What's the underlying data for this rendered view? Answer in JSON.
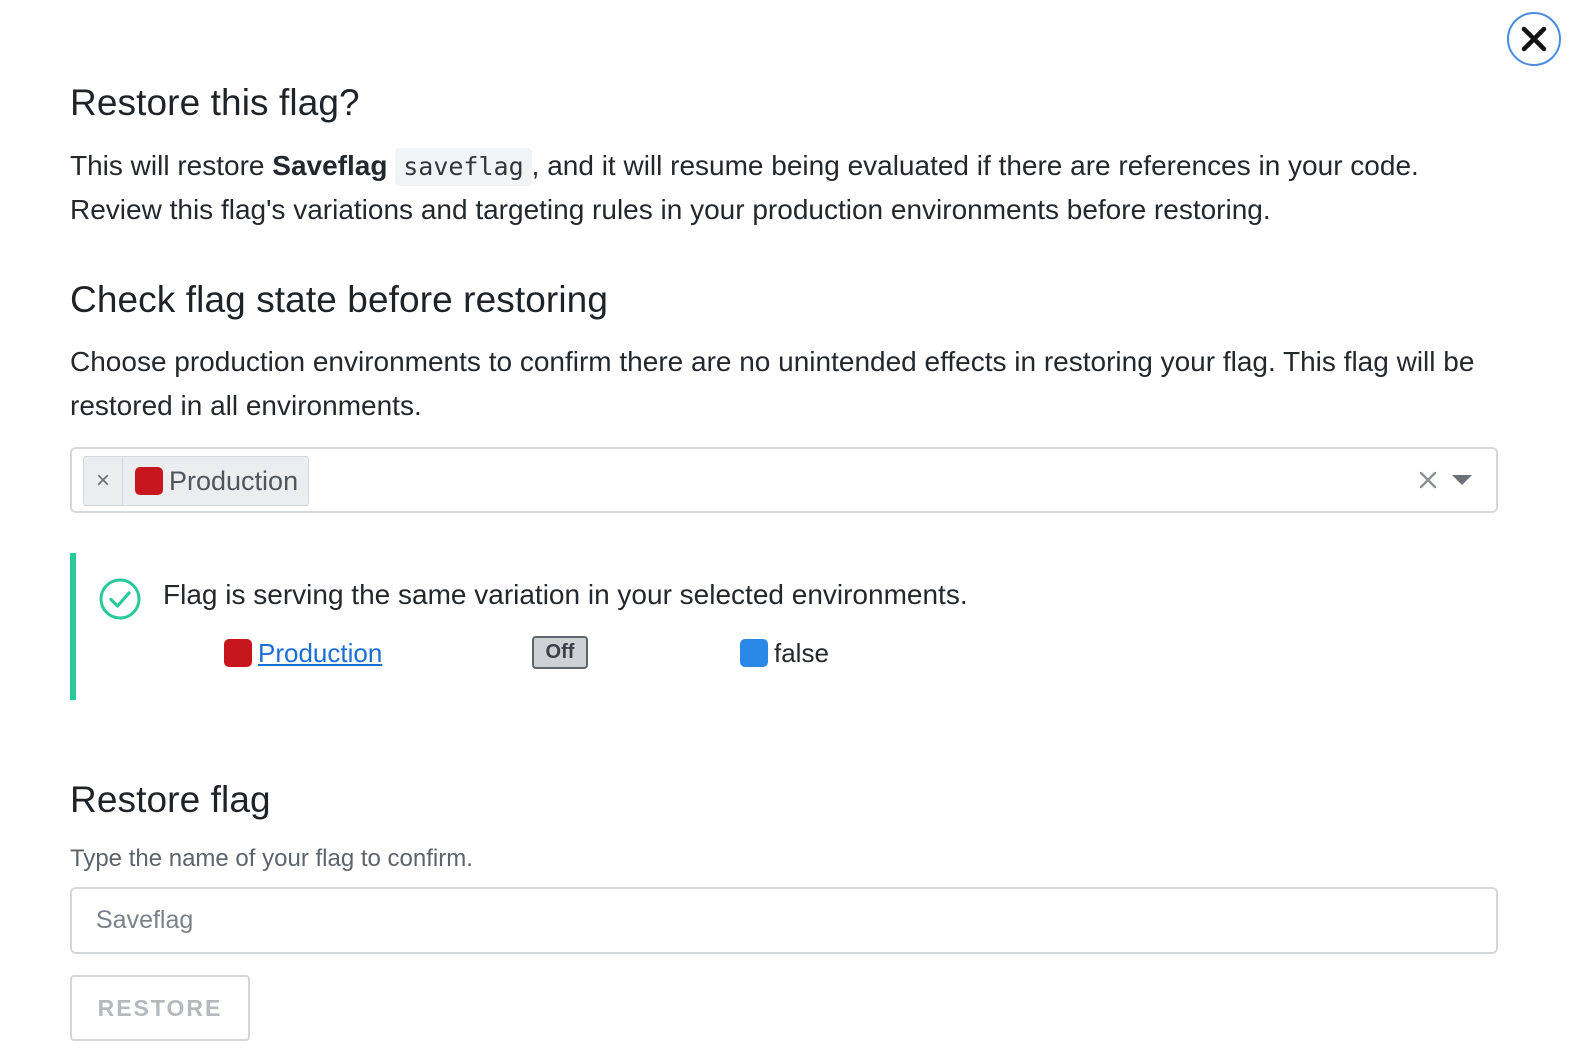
{
  "dialog": {
    "close_icon": "close-icon",
    "title": "Restore this flag?",
    "intro": {
      "before": "This will restore ",
      "flag_name": "Saveflag",
      "flag_key": "saveflag",
      "after": ", and it will resume being evaluated if there are references in your code. Review this flag's variations and targeting rules in your production environments before restoring."
    }
  },
  "check": {
    "title": "Check flag state before restoring",
    "description": "Choose production environments to confirm there are no unintended effects in restoring your flag. This flag will be restored in all environments.",
    "selected_environments": [
      {
        "name": "Production",
        "color": "#c7161d"
      }
    ],
    "chip_remove_label": "×",
    "clear_icon": "clear-icon",
    "dropdown_icon": "chevron-down-icon"
  },
  "status": {
    "icon": "check-circle-icon",
    "accent_color": "#2bc89a",
    "message": "Flag is serving the same variation in your selected environments.",
    "environment": {
      "name": "Production",
      "color": "#c7161d"
    },
    "targeting": "Off",
    "variation": {
      "value": "false",
      "color": "#2a89e6"
    }
  },
  "restore": {
    "title": "Restore flag",
    "hint": "Type the name of your flag to confirm.",
    "input_placeholder": "Saveflag",
    "input_value": "",
    "button_label": "RESTORE",
    "button_enabled": false
  }
}
